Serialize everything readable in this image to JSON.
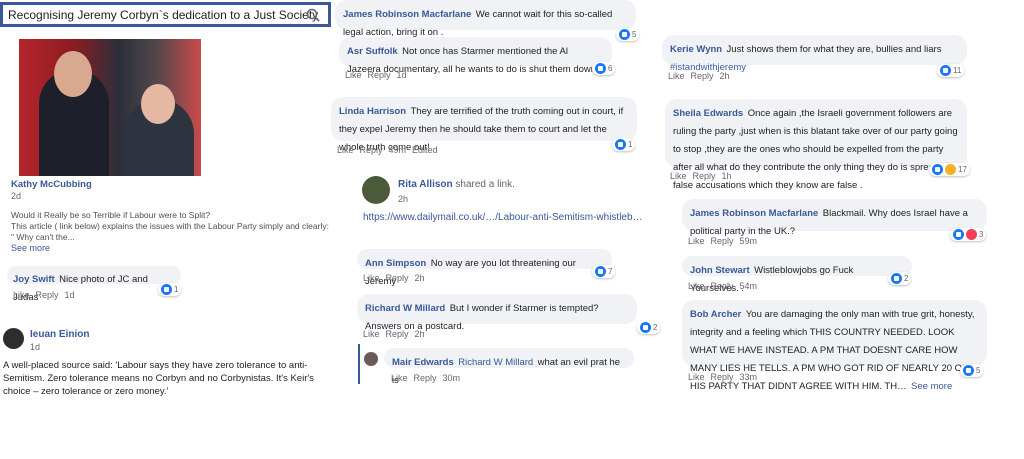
{
  "search": {
    "text": "Recognising Jeremy Corbyn`s dedication to a Just Society"
  },
  "post": {
    "author": "Kathy McCubbing",
    "time": "2d",
    "line1": "Would it Really be so Terrible if Labour were to Split?",
    "line2": "This article ( link below) explains the issues with the Labour Party simply and clearly:",
    "line3": "\" Why can't the...",
    "see_more": "See more"
  },
  "joy": {
    "name": "Joy Swift",
    "text": "Nice photo of JC and Judas",
    "like": "Like",
    "reply": "Reply",
    "time": "1d",
    "count": "1"
  },
  "ieuan": {
    "name": "Ieuan Einion",
    "time": "1d",
    "text": "A well-placed source said: 'Labour says they have zero tolerance to anti-Semitism. Zero tolerance means no Corbyn and no Corbynistas. It's Keir's choice – zero tolerance or zero money.'"
  },
  "james1": {
    "name": "James Robinson Macfarlane",
    "text": "We cannot wait for this so-called legal action, bring it on .",
    "count": "5"
  },
  "asr": {
    "name": "Asr Suffolk",
    "text": "Not once has Starmer mentioned the Al Jazeera documentary, all he wants to do is shut them down.",
    "like": "Like",
    "reply": "Reply",
    "time": "1d",
    "count": "6"
  },
  "linda": {
    "name": "Linda Harrison",
    "text": "They are terrified of the truth coming out in court, if they expel Jeremy then he should take them to court and let the whole truth come out!",
    "like": "Like",
    "reply": "Reply",
    "time": "49m",
    "edited": "Edited",
    "count": "1"
  },
  "rita": {
    "name": "Rita Allison",
    "action": "shared a link.",
    "time": "2h",
    "url": "https://www.dailymail.co.uk/…/Labour-anti-Semitism-whistleb…"
  },
  "ann": {
    "name": "Ann Simpson",
    "text": "No way are you lot threatening our Jeremy",
    "like": "Like",
    "reply": "Reply",
    "time": "2h",
    "count": "7"
  },
  "richard": {
    "name": "Richard W Millard",
    "text": "But I wonder if Starmer is tempted? Answers on a postcard.",
    "like": "Like",
    "reply": "Reply",
    "time": "2h",
    "count": "2"
  },
  "mair": {
    "name": "Mair Edwards",
    "tag": "Richard W Millard",
    "text": "what an evil prat he is",
    "like": "Like",
    "reply": "Reply",
    "time": "30m"
  },
  "kerie": {
    "name": "Kerie Wynn",
    "text": "Just shows them for what they are, bullies and liars",
    "hashtag": "#istandwithjeremy",
    "like": "Like",
    "reply": "Reply",
    "time": "2h",
    "count": "11"
  },
  "sheila": {
    "name": "Sheila Edwards",
    "text": "Once again ,the Israeli government followers are ruling the party ,just when is this blatant take over of our party going to stop ,they are the ones who should be expelled from the party after all what do they contribute the only thing they do is spread false accusations which they know are false .",
    "like": "Like",
    "reply": "Reply",
    "time": "1h",
    "count": "17"
  },
  "james2": {
    "name": "James Robinson Macfarlane",
    "text": "Blackmail. Why does Israel have a political party in the UK.?",
    "like": "Like",
    "reply": "Reply",
    "time": "59m",
    "count": "3"
  },
  "john": {
    "name": "John Stewart",
    "text": "Wistleblowjobs go Fuck Yourselves. .",
    "like": "Like",
    "reply": "Reply",
    "time": "54m",
    "count": "2"
  },
  "bob": {
    "name": "Bob Archer",
    "text": "You are damaging the only man with true grit, honesty, integrity and a feeling which THIS COUNTRY NEEDED. LOOK WHAT WE HAVE INSTEAD. A PM THAT DOESNT CARE HOW MANY LIES HE TELLS. A PM WHO GOT RID OF NEARLY 20 OF HIS PARTY THAT DIDNT AGREE WITH HIM. TH…",
    "see_more": "See more",
    "like": "Like",
    "reply": "Reply",
    "time": "33m",
    "count": "5"
  }
}
